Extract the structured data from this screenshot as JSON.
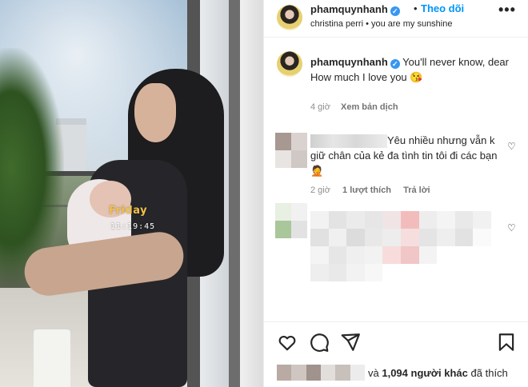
{
  "photo": {
    "overlay_day": "Friday",
    "overlay_time": "11:19:45"
  },
  "header": {
    "username": "phamquynhanh",
    "separator": "•",
    "follow_label": "Theo dõi",
    "audio": "christina perri • you are my sunshine",
    "more_icon": "more-icon"
  },
  "caption": {
    "username": "phamquynhanh",
    "text": "You'll never know, dear\nHow much I love you 😘",
    "time": "4 giờ",
    "translate_label": "Xem bản dịch"
  },
  "comments": [
    {
      "text": "Yêu nhiều nhưng vẫn k giữ chân của kẻ đa tình tin tôi đi các bạn 🤦",
      "time": "2 giờ",
      "likes_label": "1 lượt thích",
      "reply_label": "Trả lời"
    },
    {
      "text": ""
    }
  ],
  "icons": {
    "like": "heart-icon",
    "comment": "comment-icon",
    "share": "share-icon",
    "save": "bookmark-icon"
  },
  "likes": {
    "prefix": "và",
    "count_label": "1,094 người khác",
    "suffix": "đã thích"
  },
  "colors": {
    "accent": "#0095f6",
    "verified": "#3897f0",
    "text": "#262626",
    "muted": "#8e8e8e",
    "overlay_day": "#f2c14a"
  }
}
